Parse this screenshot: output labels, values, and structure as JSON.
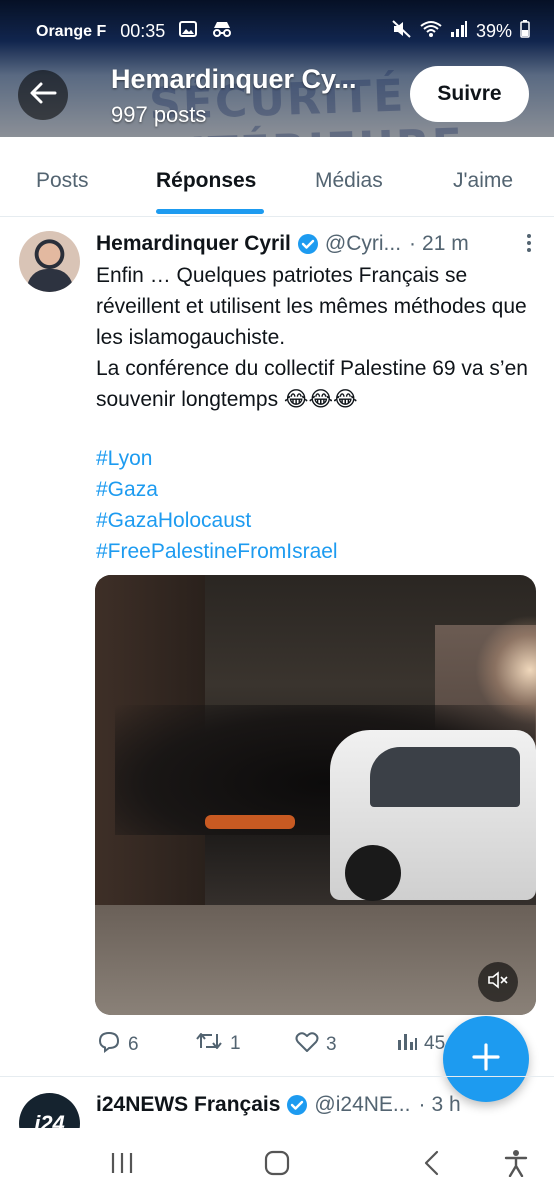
{
  "status_bar": {
    "carrier": "Orange F",
    "time": "00:35",
    "battery": "39%"
  },
  "header": {
    "title": "Hemardinquer Cy...",
    "post_count": "997 posts",
    "follow_label": "Suivre",
    "banner_text": "SÉCURITÉ INTÉRIEURE"
  },
  "tabs": [
    {
      "label": "Posts"
    },
    {
      "label": "Réponses"
    },
    {
      "label": "Médias"
    },
    {
      "label": "J'aime"
    }
  ],
  "tweet": {
    "author_name": "Hemardinquer Cyril",
    "handle": "@Cyri...",
    "separator": "·",
    "time": "21 m",
    "text_lines": [
      "Enfin … Quelques patriotes Français se réveillent et utilisent les mêmes méthodes que les islamogauchiste.",
      "La conférence du collectif Palestine 69 va s’en souvenir longtemps 😂😂😂"
    ],
    "hashtags": [
      "#Lyon",
      "#Gaza",
      "#GazaHolocaust",
      "#FreePalestineFromIsrael"
    ],
    "replies": "6",
    "retweets": "1",
    "likes": "3",
    "views": "45"
  },
  "tweet2": {
    "author_name": "i24NEWS Français",
    "handle": "@i24NE...",
    "separator": "·",
    "time": "3 h",
    "avatar_text": "i24"
  },
  "colors": {
    "accent": "#1d9bf0",
    "text": "#0f1419",
    "secondary": "#536471"
  }
}
